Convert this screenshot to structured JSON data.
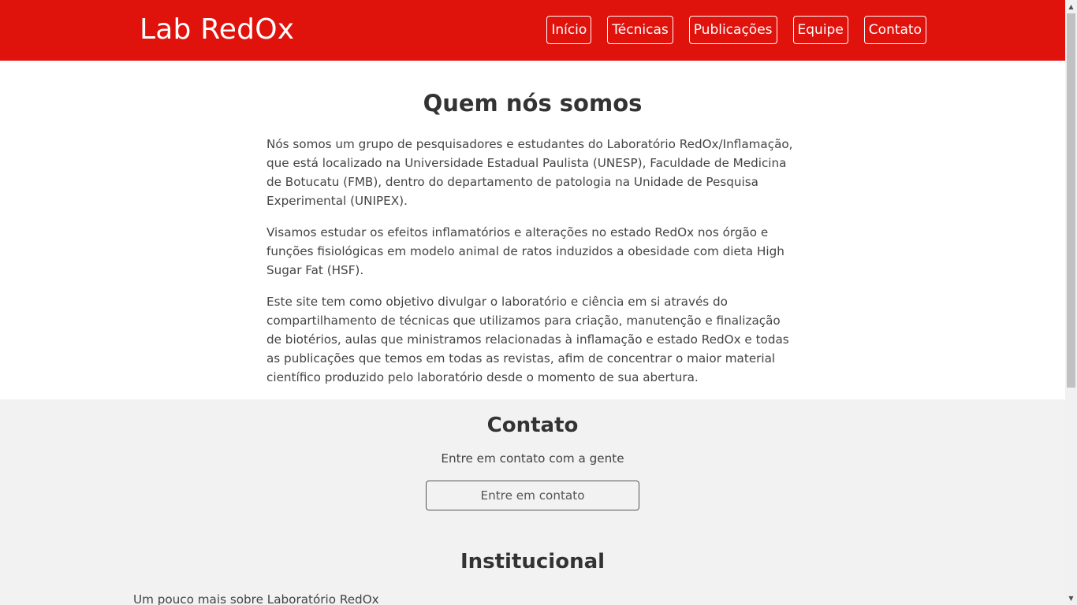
{
  "header": {
    "brand": "Lab RedOx",
    "nav": [
      "Início",
      "Técnicas",
      "Publicações",
      "Equipe",
      "Contato"
    ]
  },
  "about": {
    "title": "Quem nós somos",
    "paragraphs": [
      "Nós somos um grupo de pesquisadores e estudantes do Laboratório RedOx/Inflamação, que está localizado na Universidade Estadual Paulista (UNESP), Faculdade de Medicina de Botucatu (FMB), dentro do departamento de patologia na Unidade de Pesquisa Experimental (UNIPEX).",
      "Visamos estudar os efeitos inflamatórios e alterações no estado RedOx nos órgão e funções fisiológicas em modelo animal de ratos induzidos a obesidade com dieta High Sugar Fat (HSF).",
      "Este site tem como objetivo divulgar o laboratório e ciência em si através do compartilhamento de técnicas que utilizamos para criação, manutenção e finalização de biotérios, aulas que ministramos relacionadas à inflamação e estado RedOx e todas as publicações que temos em todas as revistas, afim de concentrar o maior material científico produzido pelo laboratório desde o momento de sua abertura."
    ]
  },
  "contact": {
    "title": "Contato",
    "subtitle": "Entre em contato com a gente",
    "button_label": "Entre em contato"
  },
  "institutional": {
    "title": "Institucional",
    "subtitle": "Um pouco mais sobre Laboratório RedOx"
  },
  "colors": {
    "header_bg": "#e0120c",
    "footer_bg": "#f2f2f2"
  }
}
